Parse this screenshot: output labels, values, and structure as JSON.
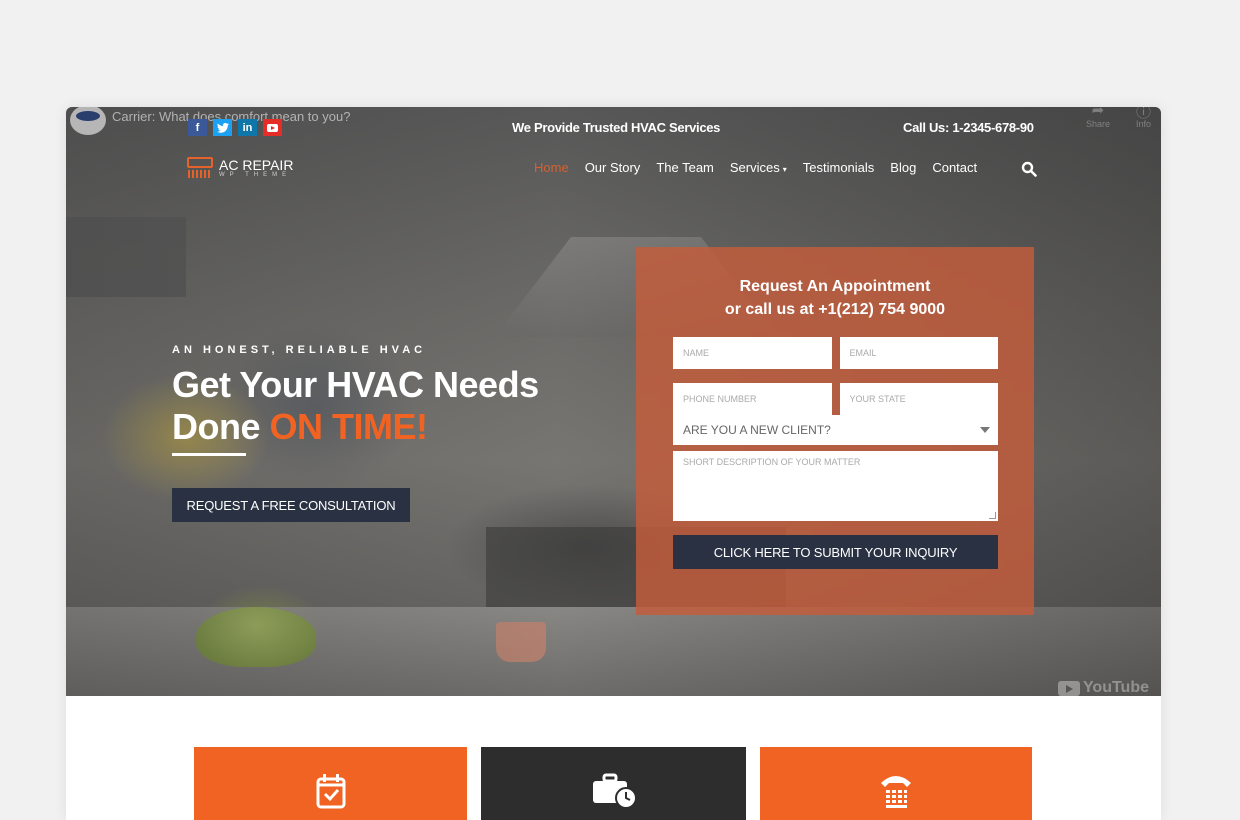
{
  "video": {
    "title": "Carrier: What does comfort mean to you?",
    "actions": [
      {
        "label": "Share",
        "icon": "share-icon"
      },
      {
        "label": "Info",
        "icon": "info-icon"
      }
    ],
    "brand": "YouTube"
  },
  "topbar": {
    "social": [
      {
        "name": "facebook",
        "glyph": "f"
      },
      {
        "name": "twitter",
        "glyph": "t"
      },
      {
        "name": "linkedin",
        "glyph": "in"
      },
      {
        "name": "youtube",
        "glyph": "▶"
      }
    ],
    "tagline": "We Provide Trusted HVAC Services",
    "phone": "Call Us: 1-2345-678-90"
  },
  "logo": {
    "title": "AC REPAIR",
    "subtitle": "WP THEME"
  },
  "nav": {
    "items": [
      {
        "label": "Home",
        "active": true
      },
      {
        "label": "Our Story"
      },
      {
        "label": "The Team"
      },
      {
        "label": "Services",
        "caret": "▾"
      },
      {
        "label": "Testimonials"
      },
      {
        "label": "Blog"
      },
      {
        "label": "Contact"
      }
    ]
  },
  "hero": {
    "eyebrow": "AN HONEST, RELIABLE HVAC",
    "headline_line1": "Get Your HVAC Needs",
    "headline_line2_plain": "Done ",
    "headline_line2_accent": "ON TIME!",
    "cta_label": "REQUEST A FREE CONSULTATION"
  },
  "form": {
    "title_line1": "Request An Appointment",
    "title_line2": "or call us at +1(212) 754 9000",
    "name_placeholder": "NAME",
    "email_placeholder": "EMAIL",
    "phone_placeholder": "PHONE NUMBER",
    "state_placeholder": "YOUR STATE",
    "client_select": "ARE YOU A NEW CLIENT?",
    "description_placeholder": "SHORT DESCRIPTION OF YOUR MATTER",
    "submit_label": "CLICK HERE TO SUBMIT YOUR INQUIRY"
  },
  "features": [
    {
      "icon": "calendar-check-icon",
      "color": "#f16322"
    },
    {
      "icon": "briefcase-clock-icon",
      "color": "#2d2d2d"
    },
    {
      "icon": "phone-keypad-icon",
      "color": "#f16322"
    }
  ],
  "colors": {
    "accent": "#f16322",
    "dark_button": "#2a3142"
  }
}
